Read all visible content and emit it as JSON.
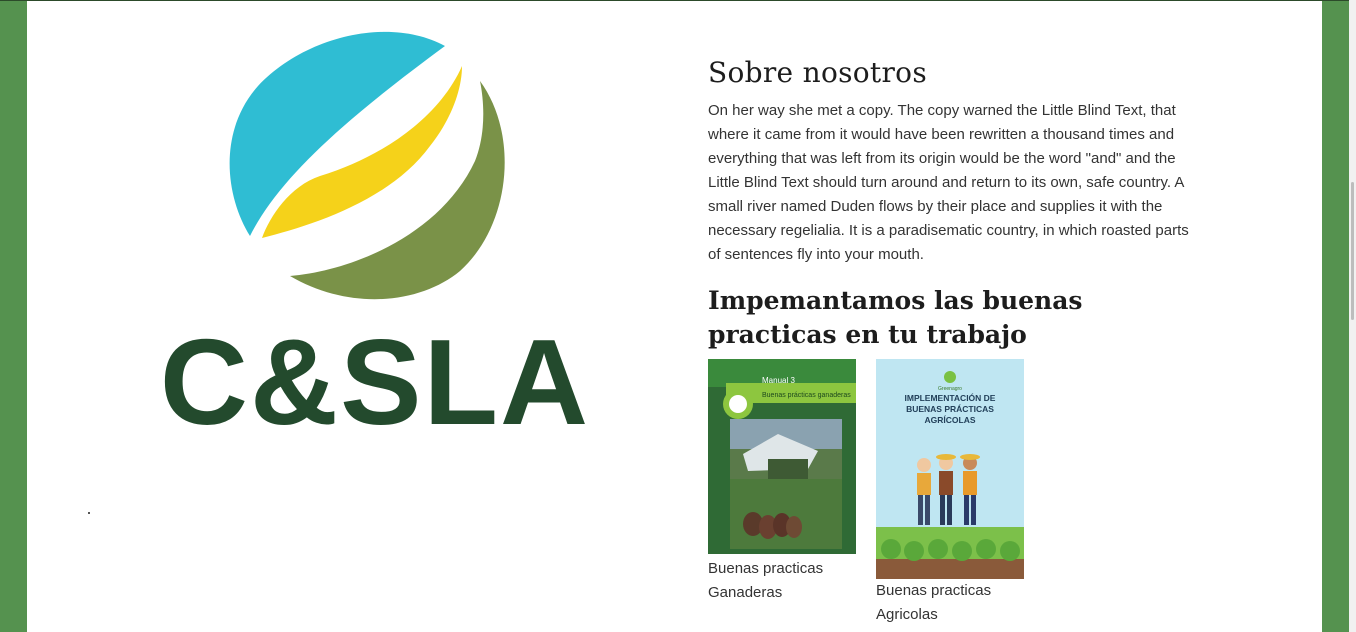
{
  "logo": {
    "text": "C&SLA",
    "colors": {
      "cyan": "#2fbdd3",
      "yellow": "#f5d21a",
      "olive": "#7a9248",
      "dark_green": "#234a2d"
    }
  },
  "about": {
    "title": "Sobre nosotros",
    "body": "On her way she met a copy. The copy warned the Little Blind Text, that where it came from it would have been rewritten a thousand times and everything that was left from its origin would be the word \"and\" and the Little Blind Text should turn around and return to its own, safe country. A small river named Duden flows by their place and supplies it with the necessary regelialia. It is a paradisematic country, in which roasted parts of sentences fly into your mouth."
  },
  "practices": {
    "title": "Impemantamos las buenas practicas en tu trabajo",
    "cards": [
      {
        "label": "Buenas practicas Ganaderas",
        "cover": {
          "badge": "Manual 3",
          "subtitle": "Buenas prácticas ganaderas"
        }
      },
      {
        "label": "Buenas practicas Agricolas",
        "cover": {
          "brand": "Greenagro",
          "title": "IMPLEMENTACIÓN DE BUENAS PRÁCTICAS AGRÍCOLAS"
        }
      }
    ]
  }
}
